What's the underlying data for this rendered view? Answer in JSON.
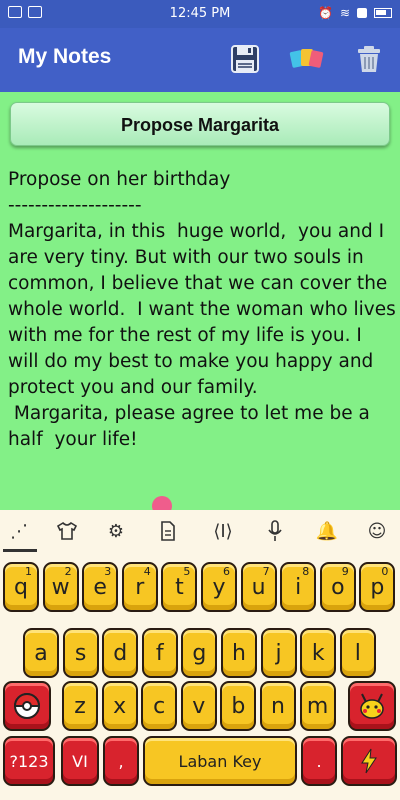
{
  "status": {
    "time": "12:45 PM"
  },
  "appbar": {
    "title": "My Notes",
    "actions": [
      {
        "name": "save-icon"
      },
      {
        "name": "color-palette-icon"
      },
      {
        "name": "trash-icon"
      }
    ]
  },
  "note": {
    "title": "Propose Margarita",
    "body": "Propose on her birthday\n--------------------\nMargarita, in this  huge world,  you and I are very tiny. But with our two souls in common, I believe that we can cover the whole world.  I want the woman who lives with me for the rest of my life is you. I will do my best to make you happy and protect you and our family.\n Margarita, please agree to let me be a half  your life!",
    "background_color": "#83f087"
  },
  "keyboard": {
    "toolbar": [
      "keyboard-dots-icon",
      "tshirt-icon",
      "settings-gear-icon",
      "document-icon",
      "text-cursor-icon",
      "microphone-icon",
      "bell-icon",
      "emoji-icon"
    ],
    "row1": [
      {
        "k": "q",
        "h": "1"
      },
      {
        "k": "w",
        "h": "2"
      },
      {
        "k": "e",
        "h": "3"
      },
      {
        "k": "r",
        "h": "4"
      },
      {
        "k": "t",
        "h": "5"
      },
      {
        "k": "y",
        "h": "6"
      },
      {
        "k": "u",
        "h": "7"
      },
      {
        "k": "i",
        "h": "8"
      },
      {
        "k": "o",
        "h": "9"
      },
      {
        "k": "p",
        "h": "0"
      }
    ],
    "row2": [
      "a",
      "s",
      "d",
      "f",
      "g",
      "h",
      "j",
      "k",
      "l"
    ],
    "row3": [
      "z",
      "x",
      "c",
      "v",
      "b",
      "n",
      "m"
    ],
    "bottom": {
      "symbols": "?123",
      "lang": "VI",
      "comma": ",",
      "space": "Laban Key",
      "period": "."
    },
    "accent_yellow": "#f7c623",
    "accent_red": "#d8232d"
  }
}
